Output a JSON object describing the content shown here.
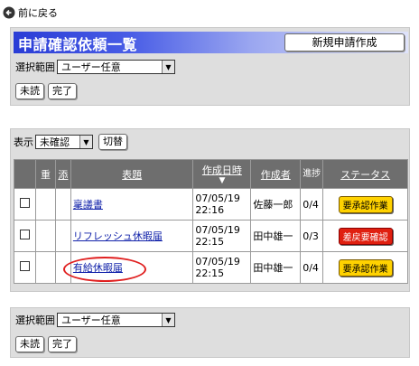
{
  "nav": {
    "back_label": "前に戻る"
  },
  "header": {
    "title": "申請確認依頼一覧",
    "new_request_label": "新規申請作成"
  },
  "range": {
    "label": "選択範囲",
    "selected": "ユーザー任意"
  },
  "buttons": {
    "unread": "未読",
    "done": "完了"
  },
  "filter": {
    "label": "表示",
    "selected": "未確認",
    "toggle_label": "切替"
  },
  "table": {
    "headers": {
      "important": "重",
      "attach": "添",
      "subject": "表題",
      "created": "作成日時",
      "sort_arrow": "▼",
      "author": "作成者",
      "progress": "進捗",
      "status": "ステータス"
    },
    "rows": [
      {
        "subject": "稟議書",
        "date": "07/05/19",
        "time": "22:16",
        "author": "佐藤一郎",
        "progress": "0/4",
        "status": "要承認作業"
      },
      {
        "subject": "リフレッシュ休暇届",
        "date": "07/05/19",
        "time": "22:15",
        "author": "田中雄一",
        "progress": "0/3",
        "status": "差戻要確認"
      },
      {
        "subject": "有給休暇届",
        "date": "07/05/19",
        "time": "22:15",
        "author": "田中雄一",
        "progress": "0/4",
        "status": "要承認作業"
      }
    ]
  },
  "colors": {
    "status_yellow": "#ffd200",
    "status_red": "#e02010",
    "title_bar": "#2a3dd6",
    "annotation": "#e02020"
  }
}
